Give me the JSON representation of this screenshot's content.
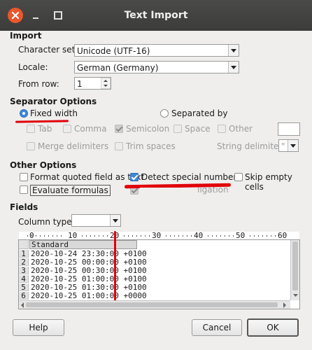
{
  "window": {
    "title": "Text Import"
  },
  "import": {
    "group_label": "Import",
    "charset_label": "Character set:",
    "charset_value": "Unicode (UTF-16)",
    "locale_label": "Locale:",
    "locale_value": "German (Germany)",
    "fromrow_label": "From row:",
    "fromrow_value": "1"
  },
  "separator": {
    "group_label": "Separator Options",
    "fixed_width": "Fixed width",
    "separated_by": "Separated by",
    "tab": "Tab",
    "comma": "Comma",
    "semicolon": "Semicolon",
    "space": "Space",
    "other": "Other",
    "merge": "Merge delimiters",
    "trim": "Trim spaces",
    "string_delim_label": "String delimiter:",
    "string_delim_value": "\""
  },
  "other": {
    "group_label": "Other Options",
    "format_quoted": "Format quoted field as text",
    "detect_special": "Detect special numbers",
    "skip_empty": "Skip empty cells",
    "evaluate": "Evaluate formulas",
    "hidden_option_tail": "ligation"
  },
  "fields": {
    "group_label": "Fields",
    "column_type_label": "Column type:",
    "column_type_value": "",
    "ruler": [
      "0",
      "10",
      "20",
      "30",
      "40",
      "50",
      "60"
    ],
    "column_header": "Standard",
    "rows": [
      {
        "num": "1",
        "text": "2020-10-24 23:30:00 +0100"
      },
      {
        "num": "2",
        "text": "2020-10-25 00:00:00 +0100"
      },
      {
        "num": "3",
        "text": "2020-10-25 00:30:00 +0100"
      },
      {
        "num": "4",
        "text": "2020-10-25 01:00:00 +0100"
      },
      {
        "num": "5",
        "text": "2020-10-25 01:30:00 +0100"
      },
      {
        "num": "6",
        "text": "2020-10-25 01:00:00 +0000"
      }
    ]
  },
  "buttons": {
    "help": "Help",
    "cancel": "Cancel",
    "ok": "OK"
  }
}
